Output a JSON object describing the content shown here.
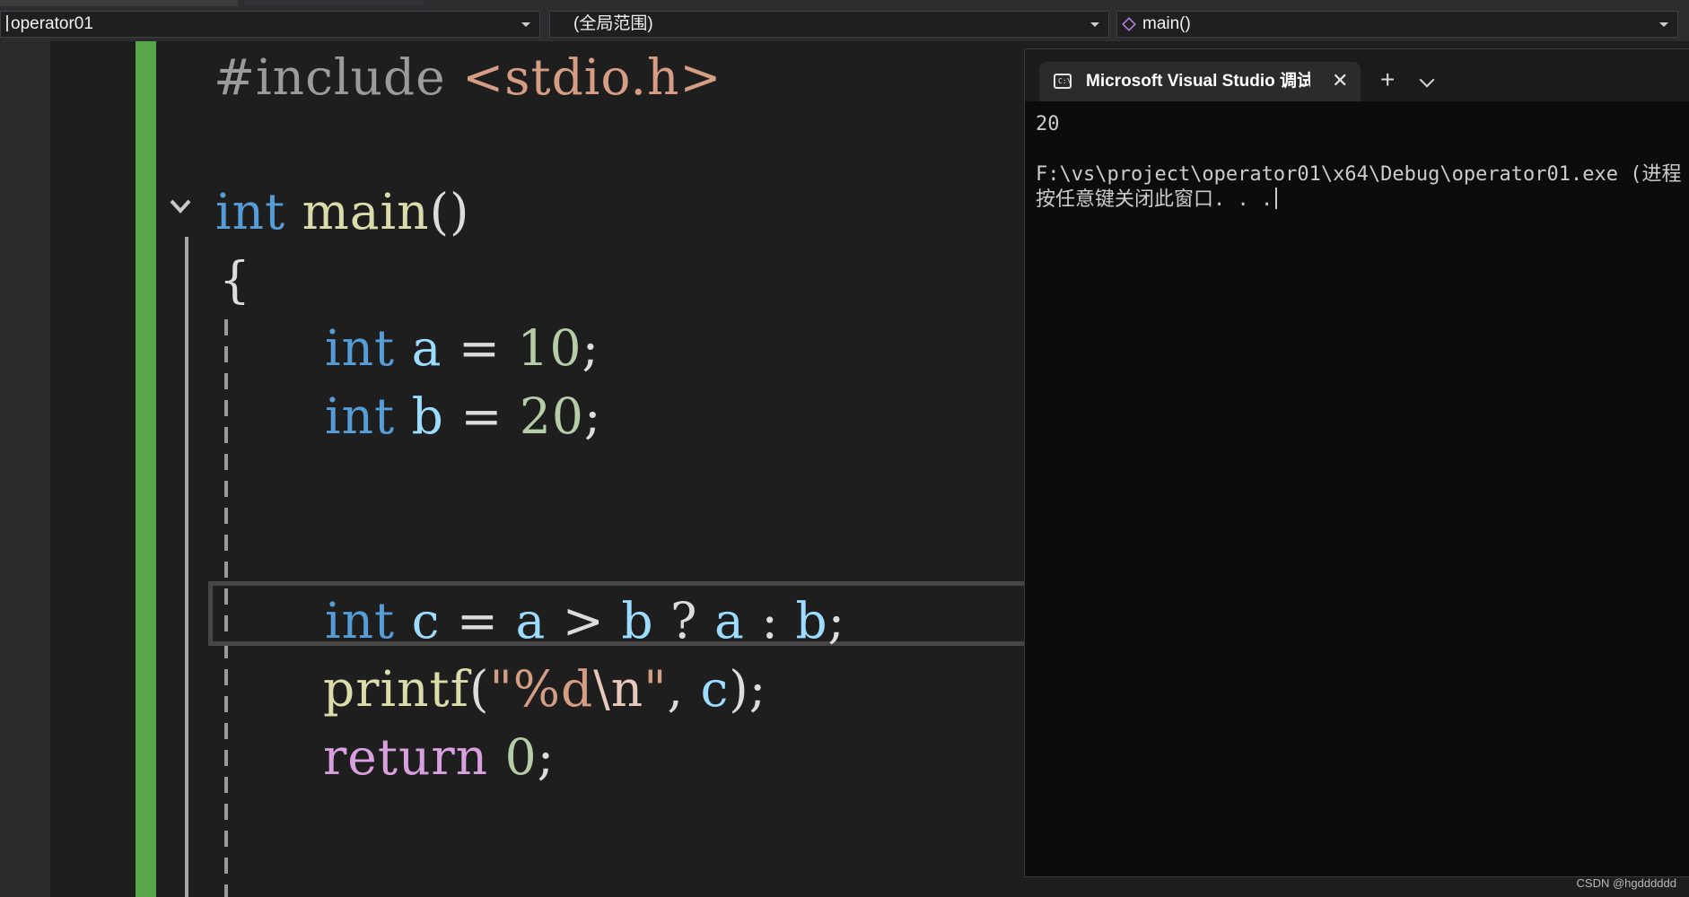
{
  "navbar": {
    "project": "operator01",
    "scope": "(全局范围)",
    "member": "main()"
  },
  "editor": {
    "lines": {
      "include_directive": "#include",
      "include_header": "<stdio.h>",
      "main_type": "int",
      "main_name": "main",
      "main_parens": "()",
      "open_brace": "{",
      "a_type": "int",
      "a_name": "a",
      "a_op": "=",
      "a_value": "10",
      "a_semi": ";",
      "b_type": "int",
      "b_name": "b",
      "b_op": "=",
      "b_value": "20",
      "b_semi": ";",
      "c_type": "int",
      "c_name": "c",
      "c_eq": "=",
      "c_cond_a": "a",
      "c_gt": ">",
      "c_cond_b": "b",
      "c_q": "?",
      "c_true": "a",
      "c_colon": ":",
      "c_false": "b",
      "c_semi": ";",
      "printf_name": "printf",
      "printf_open": "(",
      "printf_str_open": "\"%d",
      "printf_escape": "\\n",
      "printf_str_close": "\"",
      "printf_comma": ",",
      "printf_arg": "c",
      "printf_close": ");",
      "return_kw": "return",
      "return_value": "0",
      "return_semi": ";"
    }
  },
  "console": {
    "tab_title": "Microsoft Visual Studio 调试控制台",
    "close_symbol": "✕",
    "newtab_symbol": "+",
    "output_line1": "20",
    "output_line2": "F:\\vs\\project\\operator01\\x64\\Debug\\operator01.exe (进程",
    "output_line3": "按任意键关闭此窗口. . ."
  },
  "watermark": "CSDN @hgdddddd",
  "colors": {
    "keyword": "#569cd6",
    "control_keyword": "#d8a0df",
    "function": "#dcdcaa",
    "variable": "#9cdcfe",
    "number": "#b5cea8",
    "string": "#d69d85",
    "change_bar": "#57a64a"
  }
}
